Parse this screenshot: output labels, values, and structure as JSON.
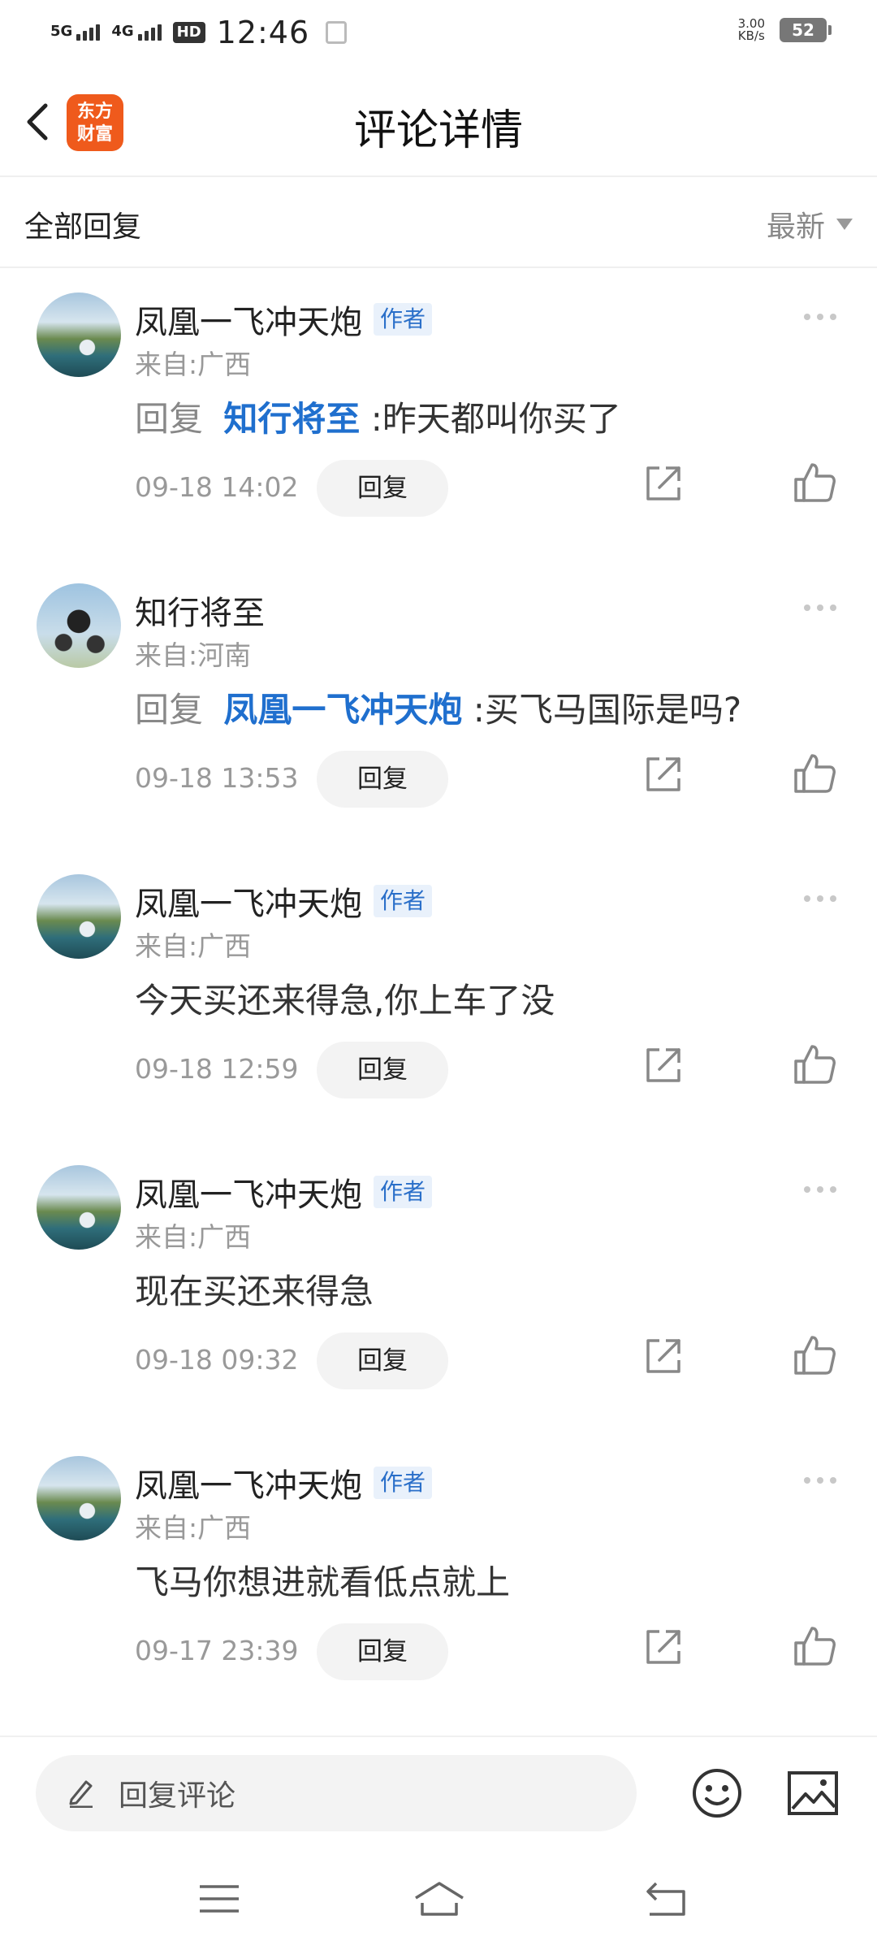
{
  "status_bar": {
    "signal1": "5G",
    "signal2": "4G",
    "hd": "HD",
    "time": "12:46",
    "speed_value": "3.00",
    "speed_unit": "KB/s",
    "battery": "52"
  },
  "header": {
    "logo_line1": "东方",
    "logo_line2": "财富",
    "title": "评论详情"
  },
  "filter": {
    "label": "全部回复",
    "sort": "最新"
  },
  "comments": [
    {
      "name": "凤凰一飞冲天炮",
      "badge": "作者",
      "from": "来自:广西",
      "reply_prefix": "回复",
      "mention": "知行将至",
      "text": ":昨天都叫你买了",
      "date": "09-18 14:02",
      "reply_btn": "回复"
    },
    {
      "name": "知行将至",
      "badge": "",
      "from": "来自:河南",
      "reply_prefix": "回复",
      "mention": "凤凰一飞冲天炮",
      "text": ":买飞马国际是吗?",
      "date": "09-18 13:53",
      "reply_btn": "回复"
    },
    {
      "name": "凤凰一飞冲天炮",
      "badge": "作者",
      "from": "来自:广西",
      "reply_prefix": "",
      "mention": "",
      "text": "今天买还来得急,你上车了没",
      "date": "09-18 12:59",
      "reply_btn": "回复"
    },
    {
      "name": "凤凰一飞冲天炮",
      "badge": "作者",
      "from": "来自:广西",
      "reply_prefix": "",
      "mention": "",
      "text": "现在买还来得急",
      "date": "09-18 09:32",
      "reply_btn": "回复"
    },
    {
      "name": "凤凰一飞冲天炮",
      "badge": "作者",
      "from": "来自:广西",
      "reply_prefix": "",
      "mention": "",
      "text": "飞马你想进就看低点就上",
      "date": "09-17 23:39",
      "reply_btn": "回复"
    }
  ],
  "input_bar": {
    "placeholder": "回复评论"
  },
  "icons": {
    "back": "back-arrow-icon",
    "more": "more-dots-icon",
    "share": "share-icon",
    "like": "thumbs-up-icon",
    "edit": "pencil-icon",
    "emoji": "emoji-icon",
    "image": "image-icon",
    "nav_menu": "menu-icon",
    "nav_home": "home-icon",
    "nav_back": "back-icon"
  },
  "colors": {
    "accent": "#1f6fce",
    "logo": "#ef5a1c"
  }
}
